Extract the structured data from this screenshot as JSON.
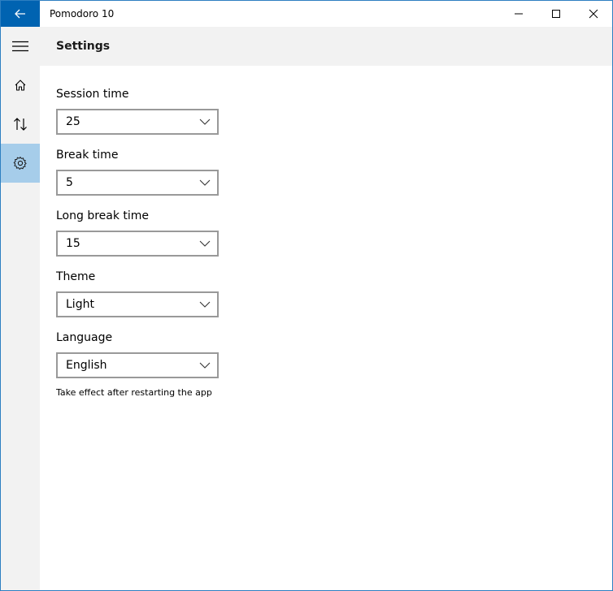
{
  "window": {
    "title": "Pomodoro 10"
  },
  "header": {
    "title": "Settings"
  },
  "nav": {
    "items": [
      {
        "icon": "hamburger-menu-icon"
      },
      {
        "icon": "home-icon"
      },
      {
        "icon": "sort-arrows-icon"
      },
      {
        "icon": "gear-icon",
        "selected": true
      }
    ]
  },
  "settings": {
    "session_time": {
      "label": "Session time",
      "value": "25"
    },
    "break_time": {
      "label": "Break time",
      "value": "5"
    },
    "long_break_time": {
      "label": "Long break time",
      "value": "15"
    },
    "theme": {
      "label": "Theme",
      "value": "Light"
    },
    "language": {
      "label": "Language",
      "value": "English"
    },
    "note": "Take effect after restarting the app"
  },
  "colors": {
    "accent": "#0063b1",
    "nav_selected": "#a6cdea",
    "chrome": "#f2f2f2",
    "border": "#999999"
  }
}
